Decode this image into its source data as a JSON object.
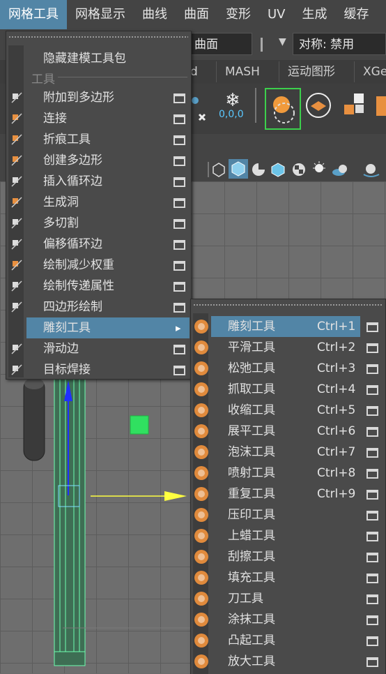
{
  "menubar": {
    "items": [
      "网格工具",
      "网格显示",
      "曲线",
      "曲面",
      "变形",
      "UV",
      "生成",
      "缓存"
    ]
  },
  "toolbar": {
    "combo1": "曲面",
    "combo2": "对称: 禁用"
  },
  "shelf": {
    "tabs": [
      "d",
      "MASH",
      "运动图形",
      "XGe"
    ],
    "snow_value": "0,0,0"
  },
  "menu_main": {
    "first_item": "隐藏建模工具包",
    "section": "工具",
    "items": [
      {
        "label": "附加到多边形",
        "icon": "append-polygon-icon"
      },
      {
        "label": "连接",
        "icon": "connect-icon"
      },
      {
        "label": "折痕工具",
        "icon": "crease-icon"
      },
      {
        "label": "创建多边形",
        "icon": "create-polygon-icon"
      },
      {
        "label": "插入循环边",
        "icon": "insert-edge-loop-icon"
      },
      {
        "label": "生成洞",
        "icon": "make-hole-icon"
      },
      {
        "label": "多切割",
        "icon": "multi-cut-icon"
      },
      {
        "label": "偏移循环边",
        "icon": "offset-edge-loop-icon"
      },
      {
        "label": "绘制减少权重",
        "icon": "paint-reduce-weights-icon"
      },
      {
        "label": "绘制传递属性",
        "icon": "paint-transfer-attributes-icon"
      },
      {
        "label": "四边形绘制",
        "icon": "quad-draw-icon"
      },
      {
        "label": "雕刻工具",
        "icon": "sculpt-tools-icon"
      },
      {
        "label": "滑动边",
        "icon": "slide-edge-icon"
      },
      {
        "label": "目标焊接",
        "icon": "target-weld-icon"
      }
    ],
    "submenu_arrow": "▸"
  },
  "menu_sculpt": {
    "items": [
      {
        "label": "雕刻工具",
        "shortcut": "Ctrl+1"
      },
      {
        "label": "平滑工具",
        "shortcut": "Ctrl+2"
      },
      {
        "label": "松弛工具",
        "shortcut": "Ctrl+3"
      },
      {
        "label": "抓取工具",
        "shortcut": "Ctrl+4"
      },
      {
        "label": "收缩工具",
        "shortcut": "Ctrl+5"
      },
      {
        "label": "展平工具",
        "shortcut": "Ctrl+6"
      },
      {
        "label": "泡沫工具",
        "shortcut": "Ctrl+7"
      },
      {
        "label": "喷射工具",
        "shortcut": "Ctrl+8"
      },
      {
        "label": "重复工具",
        "shortcut": "Ctrl+9"
      },
      {
        "label": "压印工具",
        "shortcut": ""
      },
      {
        "label": "上蜡工具",
        "shortcut": ""
      },
      {
        "label": "刮擦工具",
        "shortcut": ""
      },
      {
        "label": "填充工具",
        "shortcut": ""
      },
      {
        "label": "刀工具",
        "shortcut": ""
      },
      {
        "label": "涂抹工具",
        "shortcut": ""
      },
      {
        "label": "凸起工具",
        "shortcut": ""
      },
      {
        "label": "放大工具",
        "shortcut": ""
      }
    ]
  },
  "colors": {
    "highlight": "#5285a6",
    "sculpt_icon": "#e08a3c",
    "menu_bg": "#4a4a4a"
  }
}
